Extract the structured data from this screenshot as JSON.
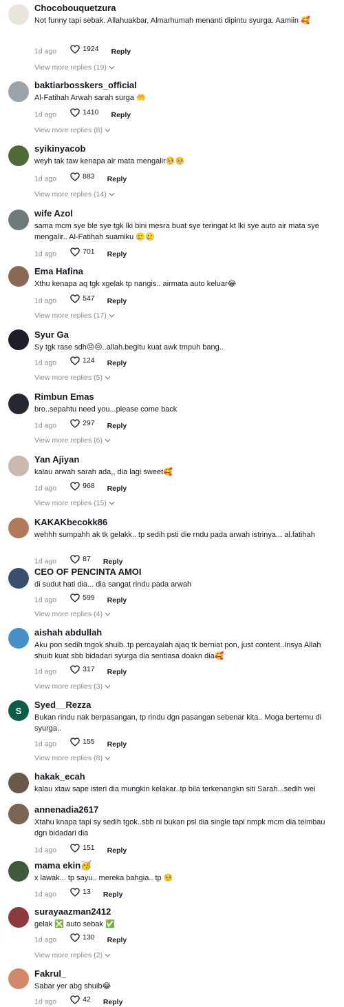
{
  "comments": [
    {
      "username": "Chocobouquetzura",
      "text": "Not funny tapi sebak. Allahuakbar, Almarhumah menanti dipintu syurga. Aamiin 🥰",
      "time": "1d ago",
      "likes": "1924",
      "reply": "Reply",
      "more": "View more replies (19)",
      "avatar_color": "#e8e4dc"
    },
    {
      "username": "baktiarbosskers_official",
      "text": "Al-Fatihah Arwah sarah surga 🤲",
      "time": "1d ago",
      "likes": "1410",
      "reply": "Reply",
      "more": "View more replies (8)",
      "avatar_color": "#9aa3a8"
    },
    {
      "username": "syikinyacob",
      "text": "weyh tak taw kenapa air mata mengalir🥺🥺",
      "time": "1d ago",
      "likes": "883",
      "reply": "Reply",
      "more": "View more replies (14)",
      "avatar_color": "#4f6b3a"
    },
    {
      "username": "wife Azol",
      "text": "sama mcm sye ble sye tgk lki bini mesra buat sye teringat kt lki sye auto air mata sye mengalir.. Al-Fatihah suamiku 🥲🥲",
      "time": "1d ago",
      "likes": "701",
      "reply": "Reply",
      "more": "",
      "avatar_color": "#6f7a7a"
    },
    {
      "username": "Ema Hafina",
      "text": "Xthu kenapa aq tgk xgelak tp nangis.. airmata auto keluar😂",
      "time": "1d ago",
      "likes": "547",
      "reply": "Reply",
      "more": "View more replies (17)",
      "avatar_color": "#8a6a55"
    },
    {
      "username": "Syur Ga",
      "text": "Sy tgk rase sdh😔😔..allah.begitu kuat awk tmpuh bang..",
      "time": "1d ago",
      "likes": "124",
      "reply": "Reply",
      "more": "View more replies (5)",
      "avatar_color": "#1e1e2a"
    },
    {
      "username": "Rimbun Emas",
      "text": "bro..sepahtu need you...please come back",
      "time": "1d ago",
      "likes": "297",
      "reply": "Reply",
      "more": "View more replies (6)",
      "avatar_color": "#252a31"
    },
    {
      "username": "Yan Ajiyan",
      "text": "kalau arwah sarah ada,, dia lagi sweet🥰",
      "time": "1d ago",
      "likes": "968",
      "reply": "Reply",
      "more": "View more replies (15)",
      "avatar_color": "#c9b8b0"
    },
    {
      "username": "KAKAKbecokk86",
      "text": "wehhh sumpahh ak tk gelakk.. tp sedih psti die rndu pada arwah istrinya... al.fatihah",
      "time": "1d ago",
      "likes": "87",
      "reply": "Reply",
      "more": "",
      "avatar_color": "#b07a5a"
    },
    {
      "username": "CEO OF PENCINTA AMOI",
      "text": "di sudut hati dia... dia sangat rindu pada arwah",
      "time": "1d ago",
      "likes": "599",
      "reply": "Reply",
      "more": "View more replies (4)",
      "avatar_color": "#3a4f6e"
    },
    {
      "username": "aishah abdullah",
      "text": "Aku pon sedih tngok shuib..tp percayalah ajaq tk berniat pon, just content..Insya Allah shuib kuat sbb bidadari syurga dia sentiasa doakn dia🥰",
      "time": "1d ago",
      "likes": "317",
      "reply": "Reply",
      "more": "View more replies (3)",
      "avatar_color": "#4a90c8"
    },
    {
      "username": "Syed__Rezza",
      "text": "Bukan rindu nak berpasangan, tp rindu dgn pasangan sebenar kita.. Moga bertemu di syurga..",
      "time": "1d ago",
      "likes": "155",
      "reply": "Reply",
      "more": "View more replies (8)",
      "avatar_color": "#0f5c4a",
      "initial": "S"
    },
    {
      "username": "hakak_ecah",
      "text": "kalau xtaw sape isteri dia mungkin kelakar..tp bila terkenangkn siti Sarah...sedih wei",
      "time": "",
      "likes": "",
      "reply": "",
      "more": "",
      "avatar_color": "#6b5a4a"
    },
    {
      "username": "annenadia2617",
      "text": "Xtahu knapa tapi sy sedih tgok..sbb ni bukan psl dia single tapi nmpk mcm dia teimbau dgn bidadari dia",
      "time": "1d ago",
      "likes": "151",
      "reply": "Reply",
      "more": "",
      "avatar_color": "#7a6555"
    },
    {
      "username": "mama ekin🥳",
      "text": "x lawak... tp sayu.. mereka bahgia.. tp 🥺",
      "time": "1d ago",
      "likes": "13",
      "reply": "Reply",
      "more": "",
      "avatar_color": "#3d5a3a"
    },
    {
      "username": "surayaazman2412",
      "text": "gelak ❎ auto sebak ✅",
      "time": "1d ago",
      "likes": "130",
      "reply": "Reply",
      "more": "View more replies (2)",
      "avatar_color": "#8a3a3a"
    },
    {
      "username": "Fakrul_",
      "text": "Sabar yer abg shuib😂",
      "time": "1d ago",
      "likes": "42",
      "reply": "Reply",
      "more": "",
      "avatar_color": "#d08a6a"
    }
  ]
}
